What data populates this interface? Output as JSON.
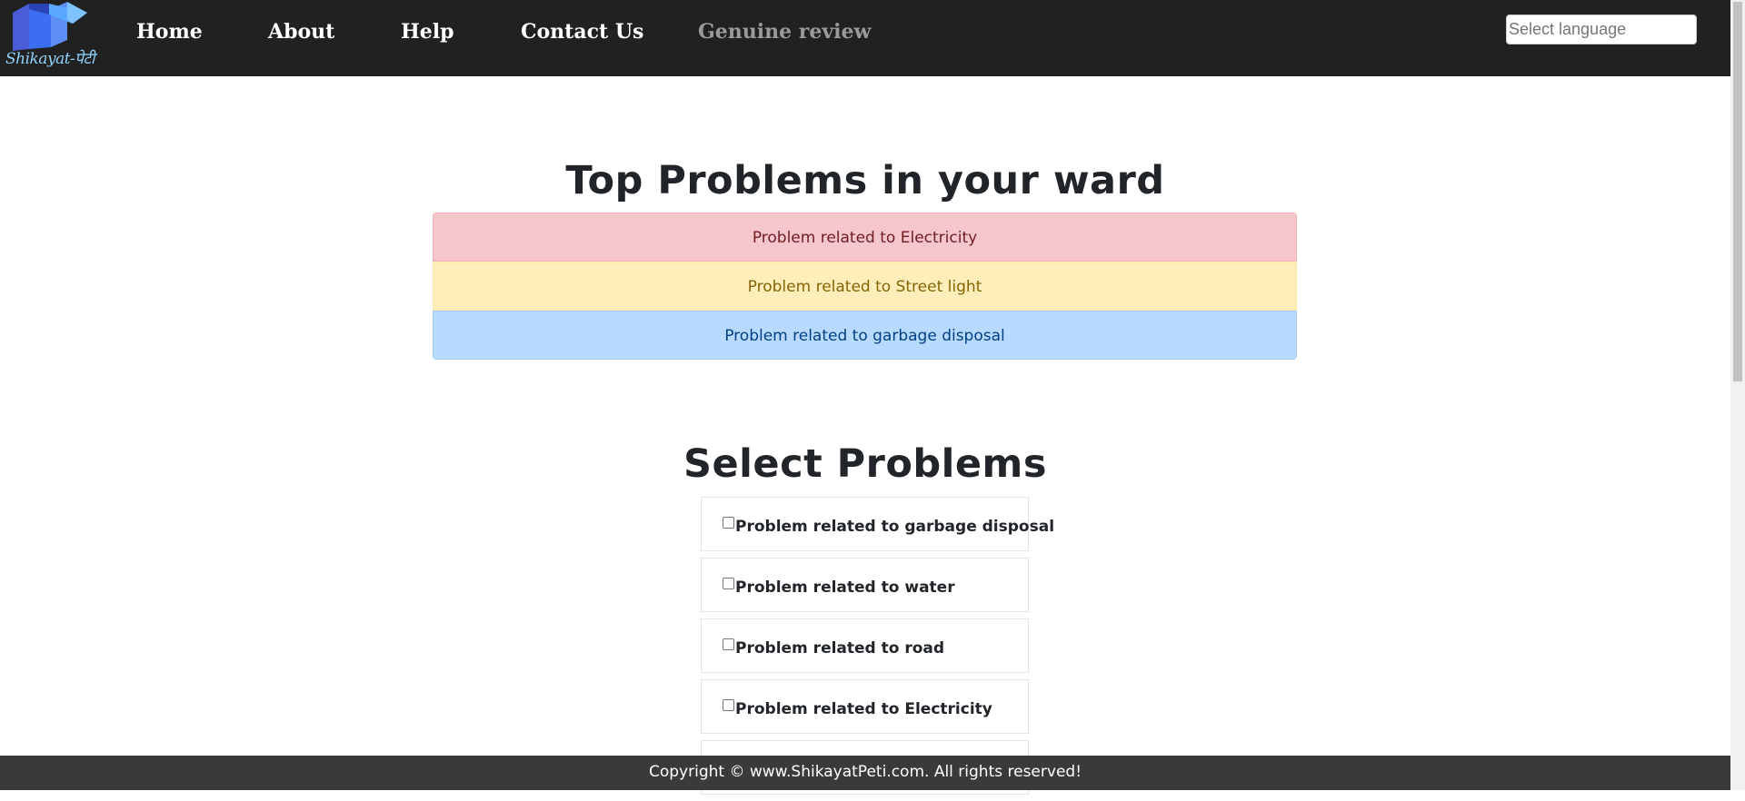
{
  "header": {
    "logo_text": "Shikayat-पेटी",
    "nav": [
      {
        "label": "Home"
      },
      {
        "label": "About"
      },
      {
        "label": "Help"
      },
      {
        "label": "Contact Us"
      },
      {
        "label": "Genuine review"
      }
    ],
    "language_select": {
      "placeholder": "Select language"
    }
  },
  "top_problems": {
    "title": "Top Problems in your ward",
    "items": [
      {
        "label": "Problem related to Electricity",
        "color": "#f5c6cb"
      },
      {
        "label": "Problem related to Street light",
        "color": "#ffeeba"
      },
      {
        "label": "Problem related to garbage disposal",
        "color": "#b8daff"
      }
    ]
  },
  "select_problems": {
    "title": "Select Problems",
    "items": [
      {
        "label": "Problem related to garbage disposal",
        "checked": false
      },
      {
        "label": "Problem related to water",
        "checked": false
      },
      {
        "label": "Problem related to road",
        "checked": false
      },
      {
        "label": "Problem related to Electricity",
        "checked": false
      }
    ]
  },
  "footer": {
    "text": "Copyright © www.ShikayatPeti.com. All rights reserved!"
  },
  "colors": {
    "navbar_bg": "#212121",
    "footer_bg": "#3a3a3a",
    "muted_link": "#9a9a9a"
  }
}
